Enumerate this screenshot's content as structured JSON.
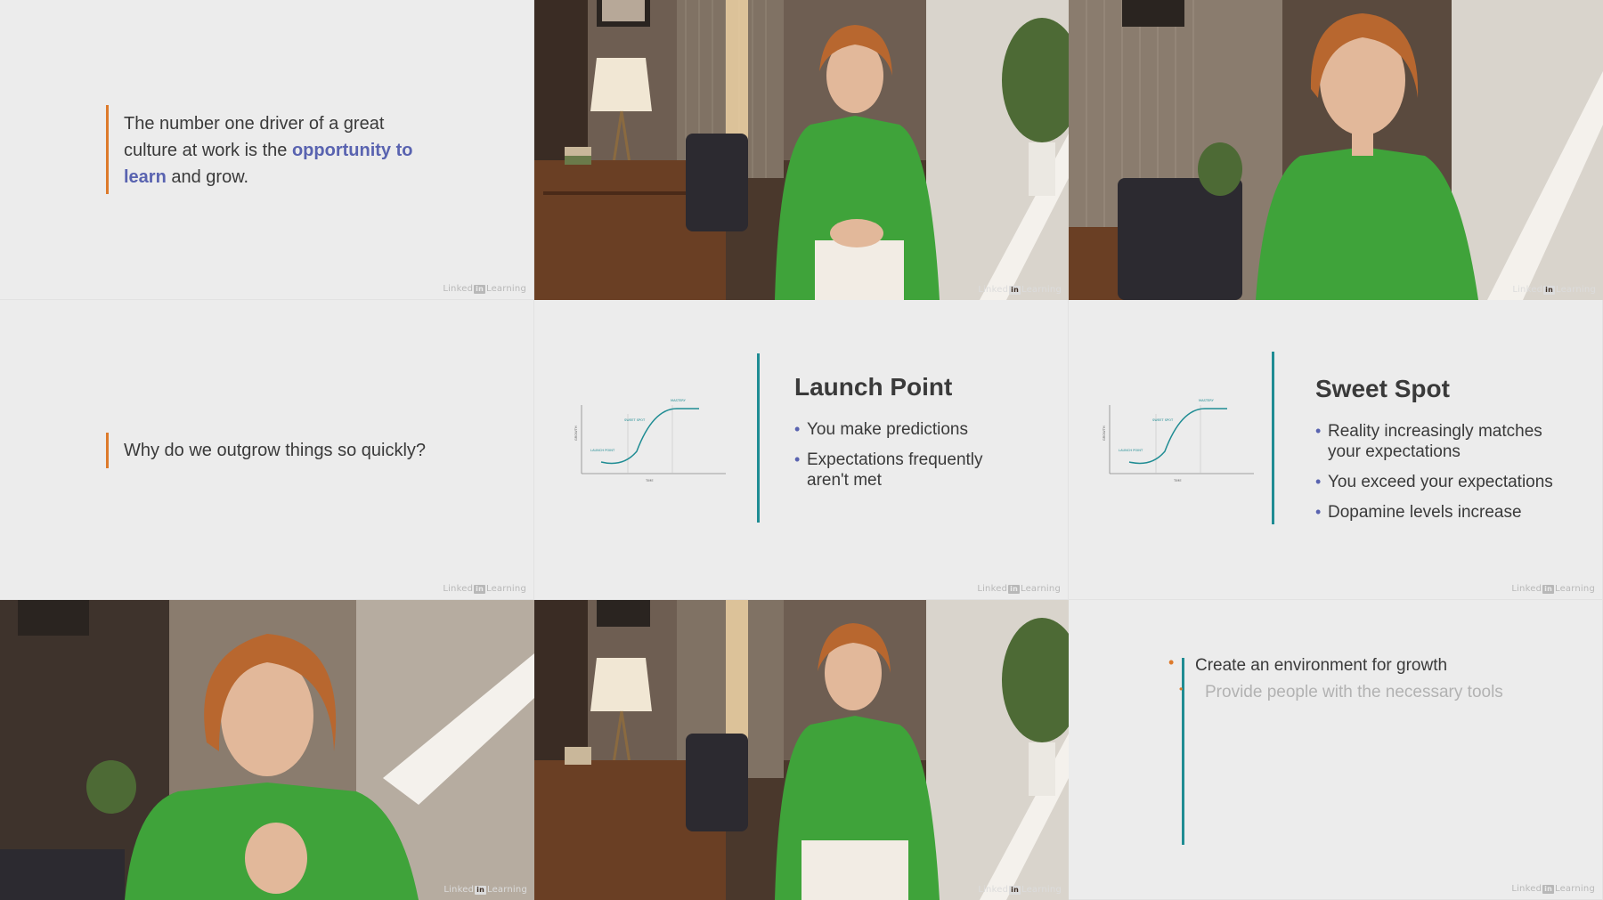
{
  "watermark": {
    "brand_left": "Linked",
    "brand_in": "in",
    "brand_right": "Learning"
  },
  "slide_quote": {
    "text_before": "The number one driver of a great culture at work is the ",
    "text_highlight": "opportunity to learn",
    "text_after": " and grow."
  },
  "slide_question": {
    "text": "Why do we outgrow things so quickly?"
  },
  "slide_launch": {
    "title": "Launch Point",
    "bullets": [
      "You make predictions",
      "Expectations frequently aren't met"
    ],
    "chart_labels": {
      "launch": "LAUNCH POINT",
      "sweet": "SWEET SPOT",
      "mastery": "MASTERY",
      "x": "TIME",
      "y": "GROWTH"
    }
  },
  "slide_sweet": {
    "title": "Sweet Spot",
    "bullets": [
      "Reality increasingly matches your expectations",
      "You exceed your expectations",
      "Dopamine levels increase"
    ],
    "chart_labels": {
      "launch": "LAUNCH POINT",
      "sweet": "SWEET SPOT",
      "mastery": "MASTERY",
      "x": "TIME",
      "y": "GROWTH"
    }
  },
  "slide_env": {
    "item1": "Create an environment for growth",
    "item2": "Provide people with the necessary tools"
  },
  "colors": {
    "accent_orange": "#dd7a2b",
    "accent_blue": "#5963b0",
    "accent_teal": "#1f8c93",
    "slide_bg": "#ececec"
  }
}
